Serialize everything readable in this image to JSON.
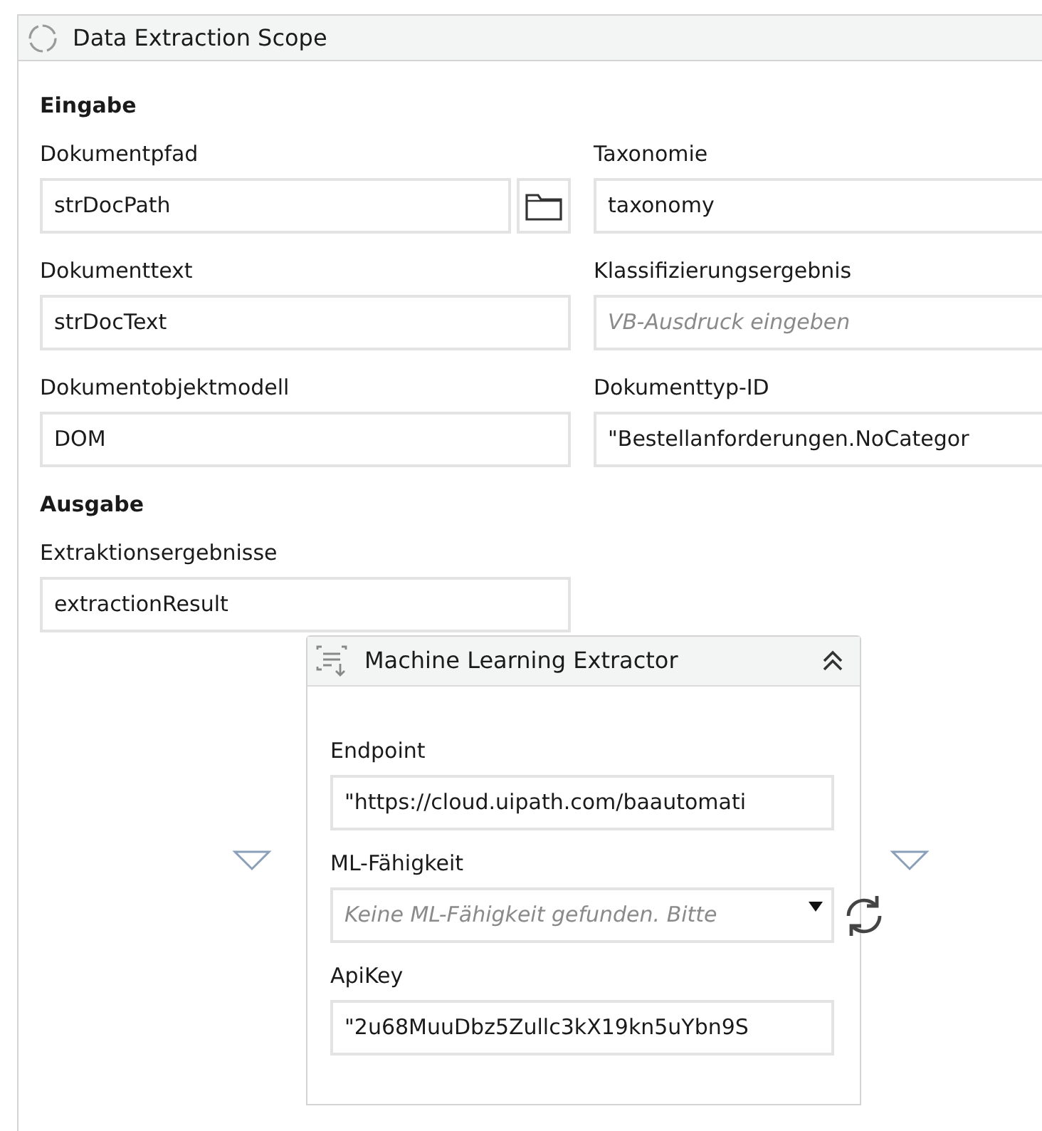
{
  "scope": {
    "title": "Data Extraction Scope"
  },
  "sections": [
    {
      "heading": "Eingabe",
      "fields": [
        {
          "kind": "path",
          "label": "Dokumentpfad",
          "value": "strDocPath"
        },
        {
          "kind": "text",
          "label": "Taxonomie",
          "value": "taxonomy"
        },
        {
          "kind": "text",
          "label": "Dokumenttext",
          "value": "strDocText"
        },
        {
          "kind": "text",
          "label": "Klassifizierungsergebnis",
          "placeholder": "VB-Ausdruck eingeben"
        },
        {
          "kind": "text",
          "label": "Dokumentobjektmodell",
          "value": "DOM"
        },
        {
          "kind": "text",
          "label": "Dokumenttyp-ID",
          "value": "\"Bestellanforderungen.NoCategor"
        }
      ]
    },
    {
      "heading": "Ausgabe",
      "fields": [
        {
          "kind": "text",
          "label": "Extraktionsergebnisse",
          "value": "extractionResult"
        }
      ]
    }
  ],
  "extractor": {
    "title": "Machine Learning Extractor",
    "expanded": true,
    "fields": [
      {
        "kind": "text",
        "label": "Endpoint",
        "value": "\"https://cloud.uipath.com/baautomati"
      },
      {
        "kind": "dropdown",
        "label": "ML-Fähigkeit",
        "placeholder": "Keine ML-Fähigkeit gefunden. Bitte"
      },
      {
        "kind": "text",
        "label": "ApiKey",
        "value": "\"2u68MuuDbz5Zullc3kX19kn5uYbn9S"
      }
    ]
  }
}
